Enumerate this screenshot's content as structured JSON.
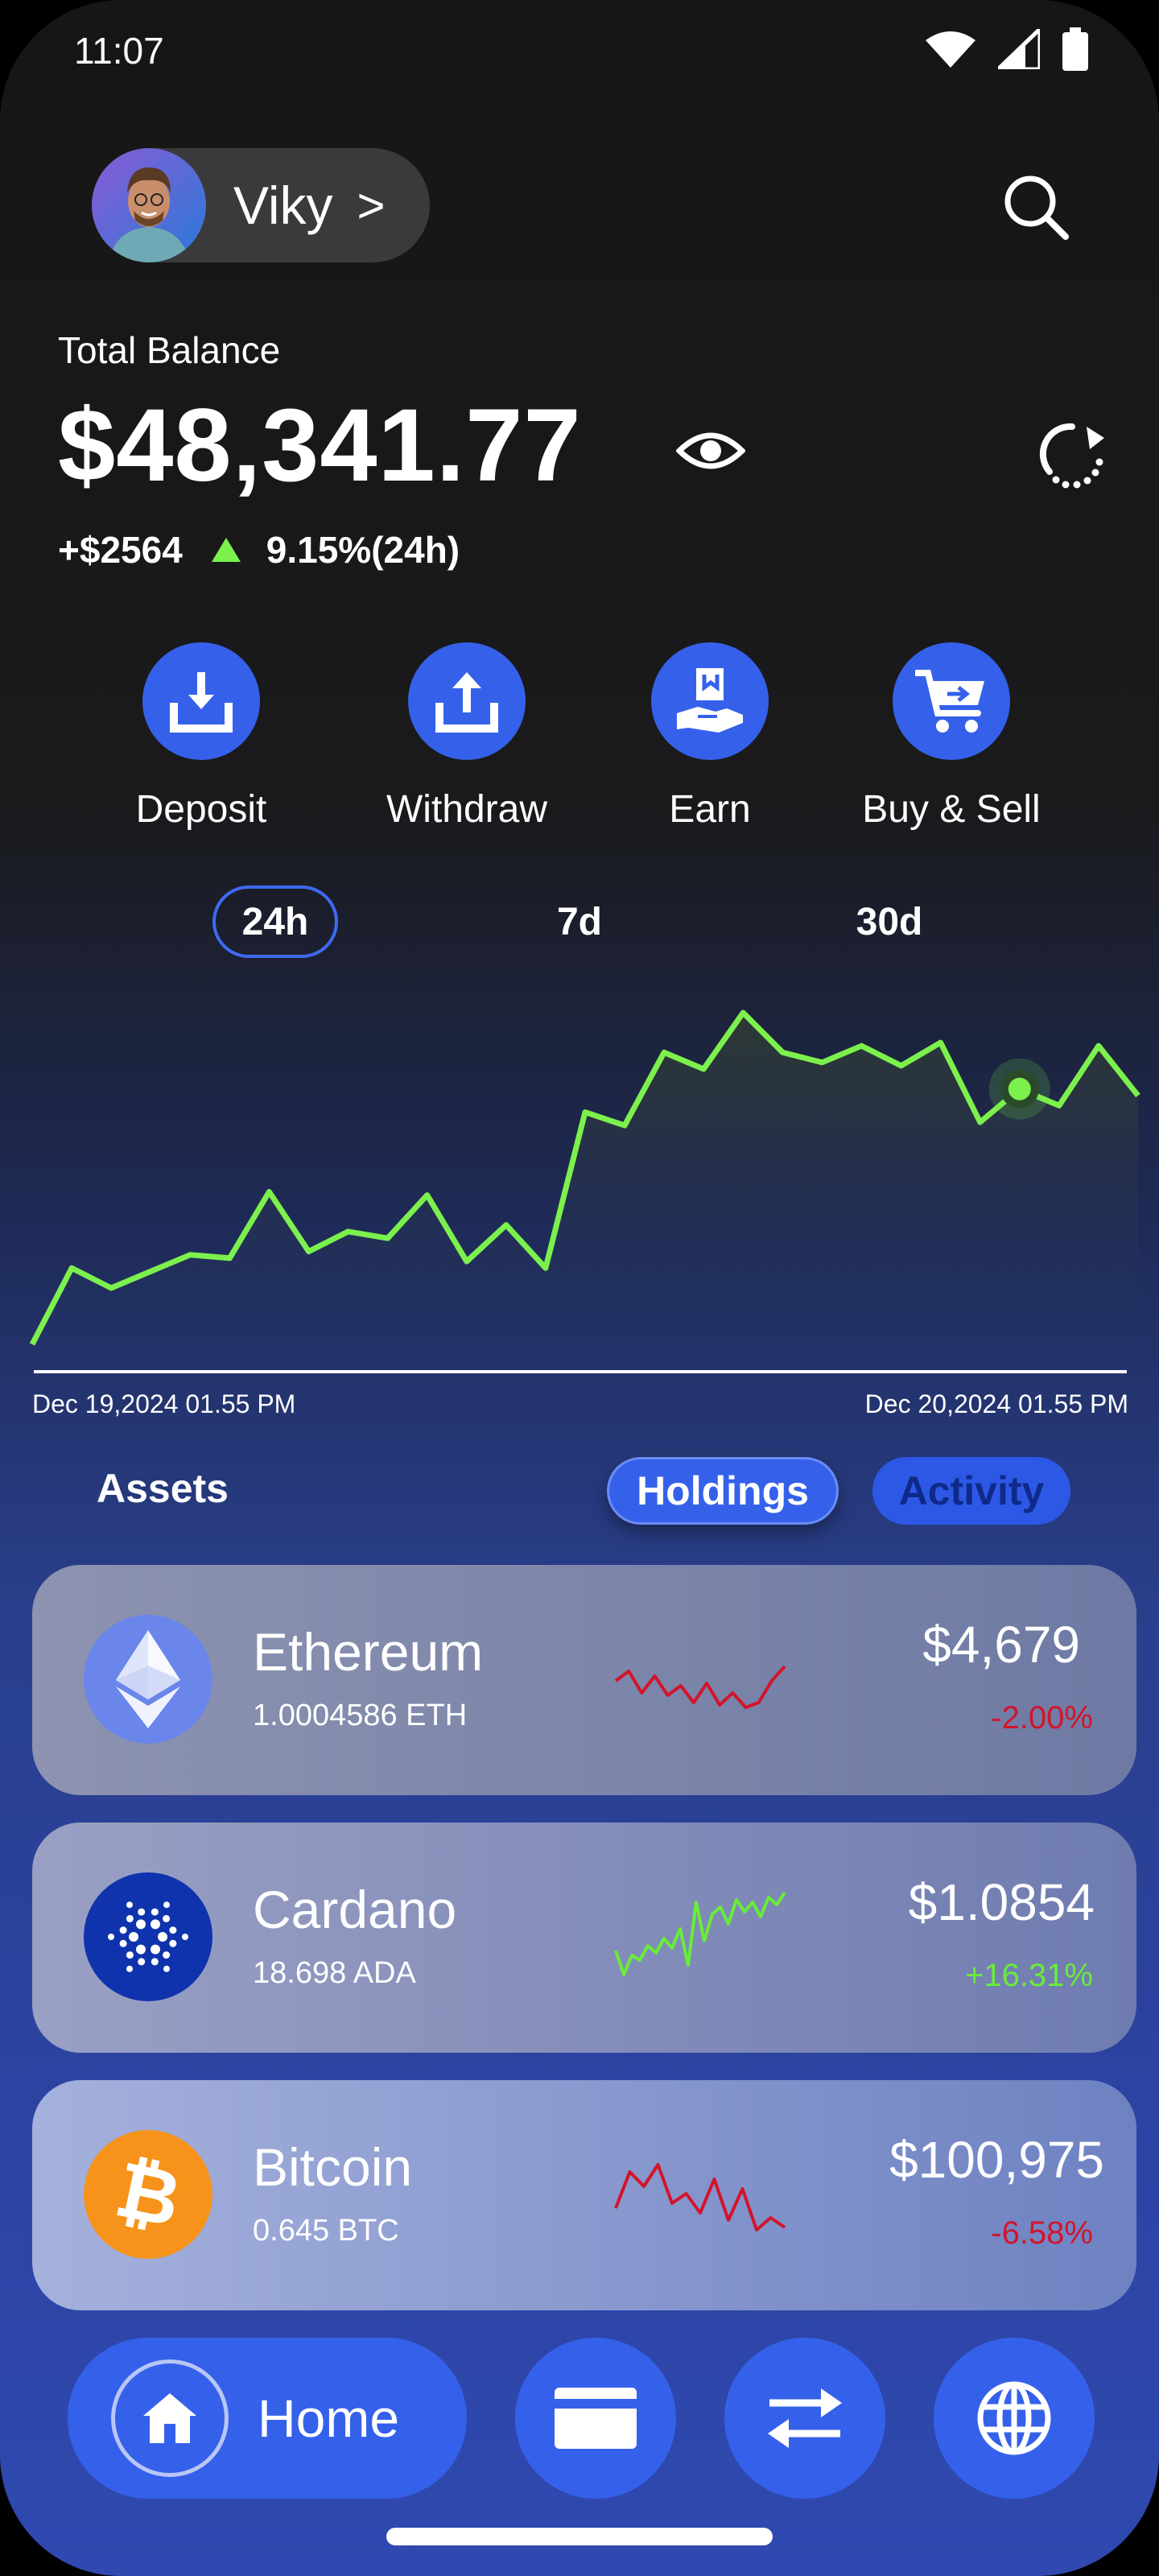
{
  "status": {
    "time": "11:07"
  },
  "profile": {
    "name": "Viky",
    "chevron": ">"
  },
  "balance": {
    "label": "Total Balance",
    "amount": "$48,341.77",
    "change_abs": "+$2564",
    "change_pct": "9.15%(24h)"
  },
  "actions": [
    {
      "label": "Deposit",
      "icon": "deposit-icon"
    },
    {
      "label": "Withdraw",
      "icon": "withdraw-icon"
    },
    {
      "label": "Earn",
      "icon": "earn-icon"
    },
    {
      "label": "Buy & Sell",
      "icon": "cart-icon"
    }
  ],
  "ranges": {
    "r24h": "24h",
    "r7d": "7d",
    "r30d": "30d",
    "active": "24h"
  },
  "chart_data": {
    "type": "area",
    "x_start": "Dec 19,2024 01.55 PM",
    "x_end": "Dec 20,2024 01.55 PM",
    "values": [
      0,
      23,
      17,
      22,
      27,
      26,
      46,
      28,
      34,
      32,
      45,
      25,
      36,
      23,
      70,
      66,
      88,
      83,
      100,
      88,
      85,
      90,
      84,
      91,
      67,
      77,
      72,
      90,
      75
    ],
    "highlight_index": 25,
    "color": "#7cf04c"
  },
  "assets": {
    "title": "Assets",
    "tab_holdings": "Holdings",
    "tab_activity": "Activity",
    "items": [
      {
        "name": "Ethereum",
        "amount": "1.0004586 ETH",
        "price": "$4,679",
        "change": "-2.00%",
        "trend": "down",
        "spark": [
          40,
          48,
          30,
          44,
          28,
          36,
          22,
          38,
          20,
          30,
          18,
          22,
          40,
          52
        ]
      },
      {
        "name": "Cardano",
        "amount": "18.698 ADA",
        "price": "$1.0854",
        "change": "+16.31%",
        "trend": "up",
        "spark": [
          30,
          10,
          26,
          22,
          34,
          28,
          40,
          32,
          48,
          18,
          70,
          38,
          60,
          66,
          52,
          72,
          62,
          70,
          58,
          74,
          68,
          78
        ]
      },
      {
        "name": "Bitcoin",
        "amount": "0.645 BTC",
        "price": "$100,975",
        "change": "-6.58%",
        "trend": "down",
        "spark": [
          30,
          60,
          48,
          66,
          34,
          42,
          26,
          54,
          20,
          46,
          12,
          22,
          14
        ]
      }
    ]
  },
  "nav": {
    "home_label": "Home",
    "items": [
      "wallet-icon",
      "transfer-icon",
      "globe-icon"
    ]
  },
  "colors": {
    "accent": "#3561ea",
    "positive": "#69ec39",
    "negative": "#d3142a",
    "line": "#7cf04c"
  }
}
